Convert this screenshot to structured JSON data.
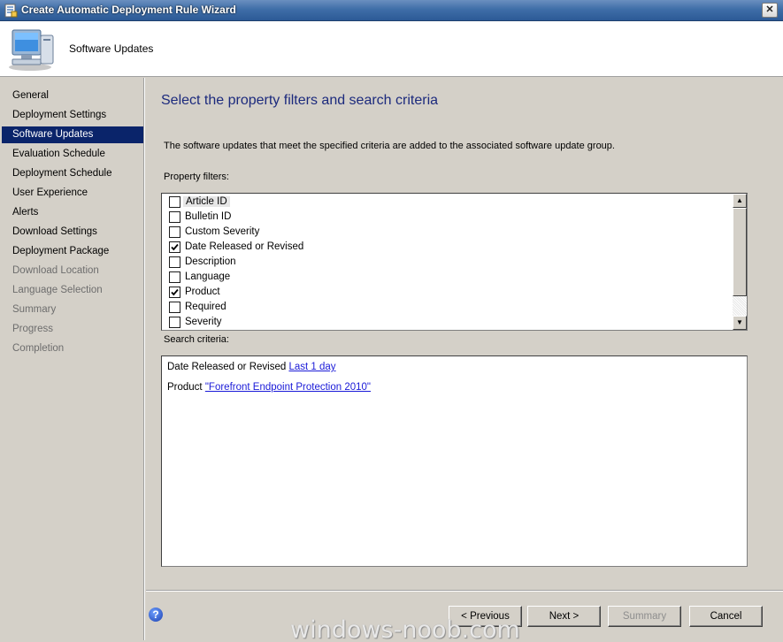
{
  "window": {
    "title": "Create Automatic Deployment Rule Wizard",
    "close_glyph": "✕"
  },
  "header": {
    "title": "Software Updates"
  },
  "nav": {
    "items": [
      {
        "label": "General",
        "state": "done"
      },
      {
        "label": "Deployment Settings",
        "state": "done"
      },
      {
        "label": "Software Updates",
        "state": "active"
      },
      {
        "label": "Evaluation Schedule",
        "state": "done"
      },
      {
        "label": "Deployment Schedule",
        "state": "done"
      },
      {
        "label": "User Experience",
        "state": "done"
      },
      {
        "label": "Alerts",
        "state": "done"
      },
      {
        "label": "Download Settings",
        "state": "done"
      },
      {
        "label": "Deployment Package",
        "state": "done"
      },
      {
        "label": "Download Location",
        "state": "todo"
      },
      {
        "label": "Language Selection",
        "state": "todo"
      },
      {
        "label": "Summary",
        "state": "todo"
      },
      {
        "label": "Progress",
        "state": "todo"
      },
      {
        "label": "Completion",
        "state": "todo"
      }
    ]
  },
  "content": {
    "heading": "Select the property filters and search criteria",
    "description": "The software updates that meet the specified criteria are added to the associated software update group.",
    "property_filters_label": "Property filters:",
    "search_criteria_label": "Search criteria:"
  },
  "filters": [
    {
      "label": "Article ID",
      "checked": false,
      "focused": true
    },
    {
      "label": "Bulletin ID",
      "checked": false
    },
    {
      "label": "Custom Severity",
      "checked": false
    },
    {
      "label": "Date Released or Revised",
      "checked": true
    },
    {
      "label": "Description",
      "checked": false
    },
    {
      "label": "Language",
      "checked": false
    },
    {
      "label": "Product",
      "checked": true
    },
    {
      "label": "Required",
      "checked": false
    },
    {
      "label": "Severity",
      "checked": false
    }
  ],
  "criteria": [
    {
      "prefix": "Date Released or Revised",
      "link": "Last 1 day"
    },
    {
      "prefix": "Product",
      "link": "\"Forefront Endpoint Protection 2010\""
    }
  ],
  "buttons": {
    "help": "?",
    "previous": "< Previous",
    "next": "Next >",
    "summary": "Summary",
    "cancel": "Cancel"
  },
  "watermark": "windows-noob.com",
  "colors": {
    "accent": "#0a246a",
    "heading": "#1c2a7d",
    "link": "#1a1ad8"
  }
}
